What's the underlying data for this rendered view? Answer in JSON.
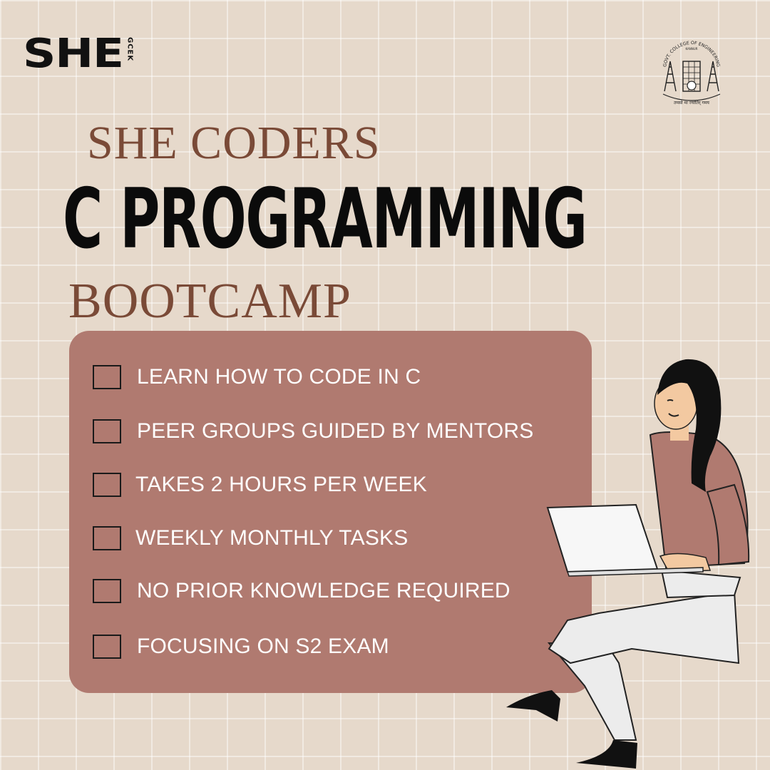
{
  "logo": {
    "main": "SHE",
    "sub": "GCEK"
  },
  "seal": {
    "label": "GOVT. COLLEGE OF ENGINEERING",
    "location": "KANNUR",
    "motto": "तमसो मा ज्योतिर् गमय"
  },
  "title": {
    "top": "SHE CODERS",
    "main": "C PROGRAMMING",
    "bottom": "BOOTCAMP"
  },
  "checklist": [
    {
      "label": "LEARN HOW TO CODE IN C",
      "checked": false
    },
    {
      "label": "PEER GROUPS GUIDED BY MENTORS",
      "checked": false
    },
    {
      "label": "TAKES  2 HOURS PER WEEK",
      "checked": false
    },
    {
      "label": "WEEKLY MONTHLY TASKS",
      "checked": false
    },
    {
      "label": "NO PRIOR KNOWLEDGE REQUIRED",
      "checked": false
    },
    {
      "label": "FOCUSING ON S2 EXAM",
      "checked": false
    }
  ],
  "colors": {
    "background": "#e6d9cb",
    "accent": "#7a4a37",
    "card": "#b07a70",
    "text_dark": "#0b0b0b"
  }
}
